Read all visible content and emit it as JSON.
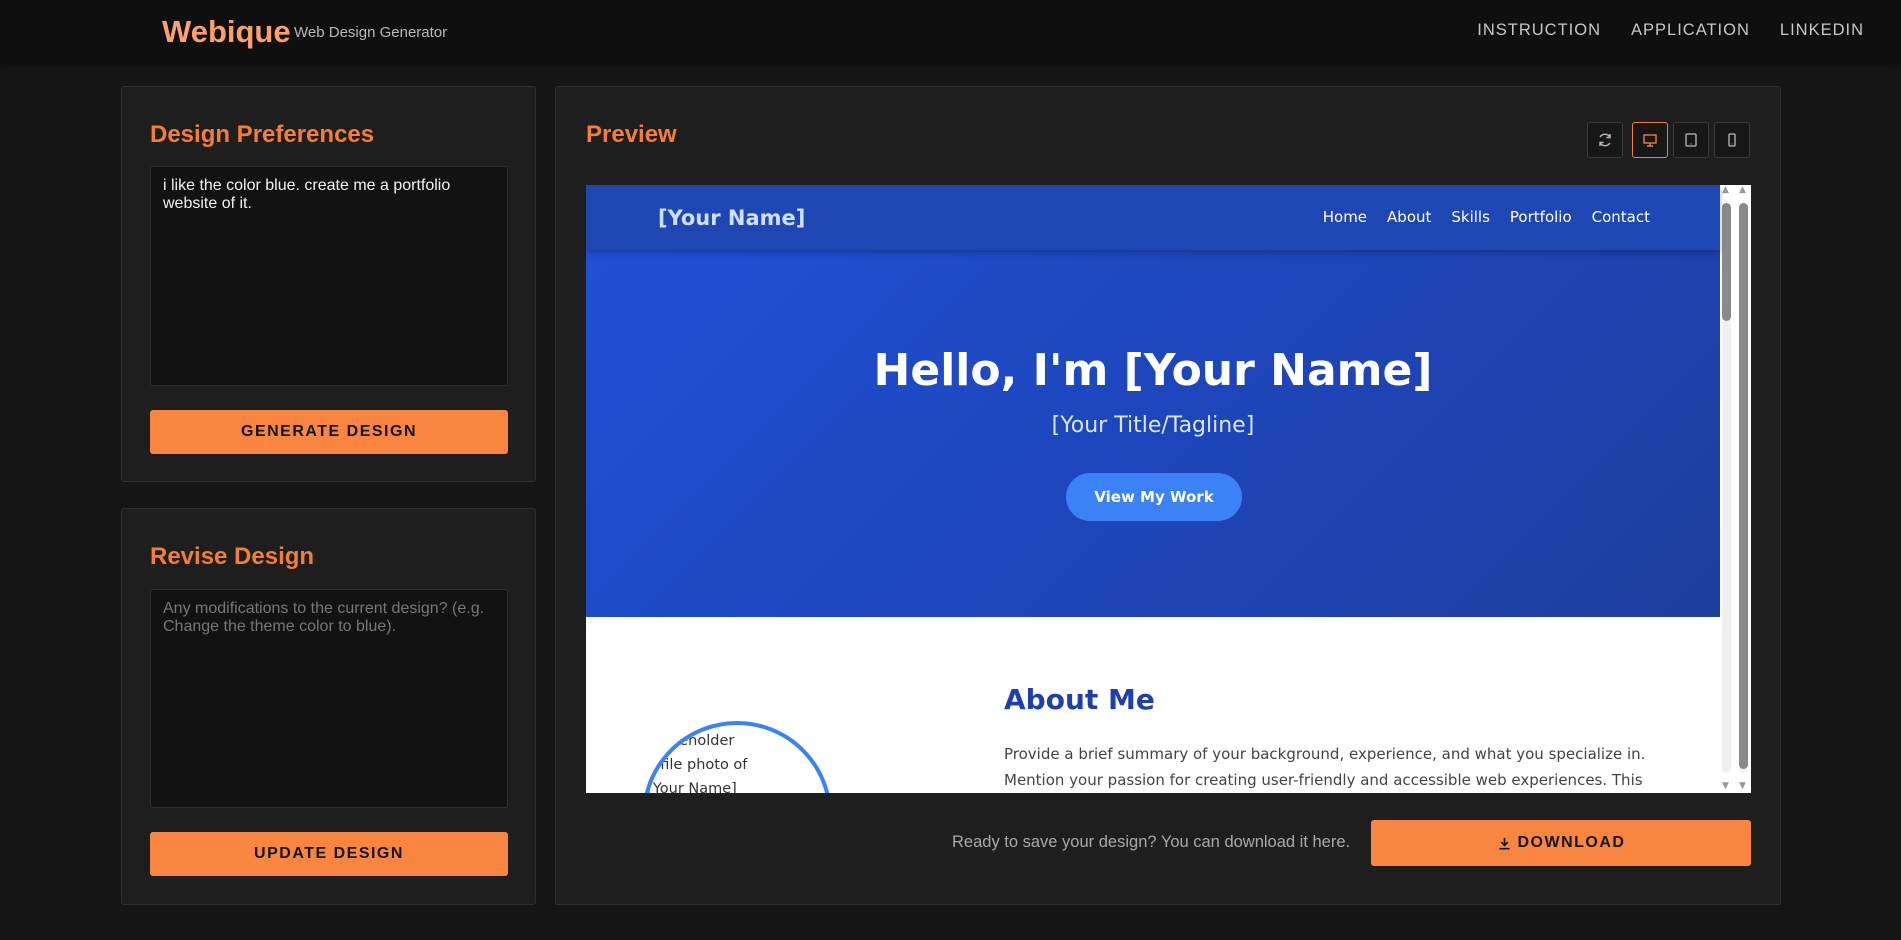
{
  "header": {
    "brand": "Webique",
    "tagline": "Web Design Generator",
    "nav": [
      "INSTRUCTION",
      "APPLICATION",
      "LINKEDIN"
    ]
  },
  "design_prefs": {
    "title": "Design Preferences",
    "input_value": "i like the color blue. create me a portfolio website of it.",
    "button": "GENERATE DESIGN"
  },
  "revise": {
    "title": "Revise Design",
    "placeholder": "Any modifications to the current design? (e.g. Change the theme color to blue).",
    "button": "UPDATE DESIGN"
  },
  "preview": {
    "title": "Preview",
    "devices": [
      "refresh-icon",
      "desktop-icon",
      "tablet-icon",
      "mobile-icon"
    ],
    "active_device": "desktop",
    "site": {
      "brand": "[Your Name]",
      "links": [
        "Home",
        "About",
        "Skills",
        "Portfolio",
        "Contact"
      ],
      "hero_title": "Hello, I'm [Your Name]",
      "hero_subtitle": "[Your Title/Tagline]",
      "hero_cta": "View My Work",
      "photo_alt": "Placeholder profile photo of [Your Name]",
      "about_title": "About Me",
      "about_text": "Provide a brief summary of your background, experience, and what you specialize in. Mention your passion for creating user-friendly and accessible web experiences. This section should"
    },
    "download_message": "Ready to save your design? You can download it here.",
    "download_button": "DOWNLOAD"
  },
  "colors": {
    "accent": "#f98640",
    "brand": "#fba06b",
    "site_primary": "#1e47b3",
    "site_button": "#3b82f6"
  }
}
